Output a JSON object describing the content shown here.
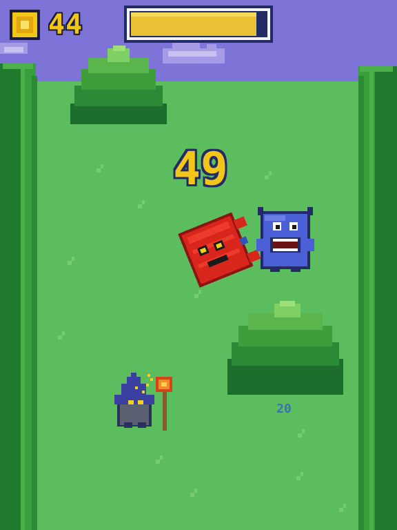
{
  "hud": {
    "coin_count": "44",
    "energy_fraction": 0.93,
    "coin_icon": "coin-icon"
  },
  "score": "49",
  "floating_points": "20",
  "characters": {
    "player": "wizard-with-flame-staff",
    "enemies": [
      "red-block-monster",
      "blue-horned-monster"
    ]
  },
  "colors": {
    "sky": "#7e74d8",
    "grass": "#5cbd5e",
    "hedge": "#2f9a3c",
    "bush": "#3f9e3c",
    "energy_fill": "#e8c234",
    "score": "#f2c619"
  }
}
